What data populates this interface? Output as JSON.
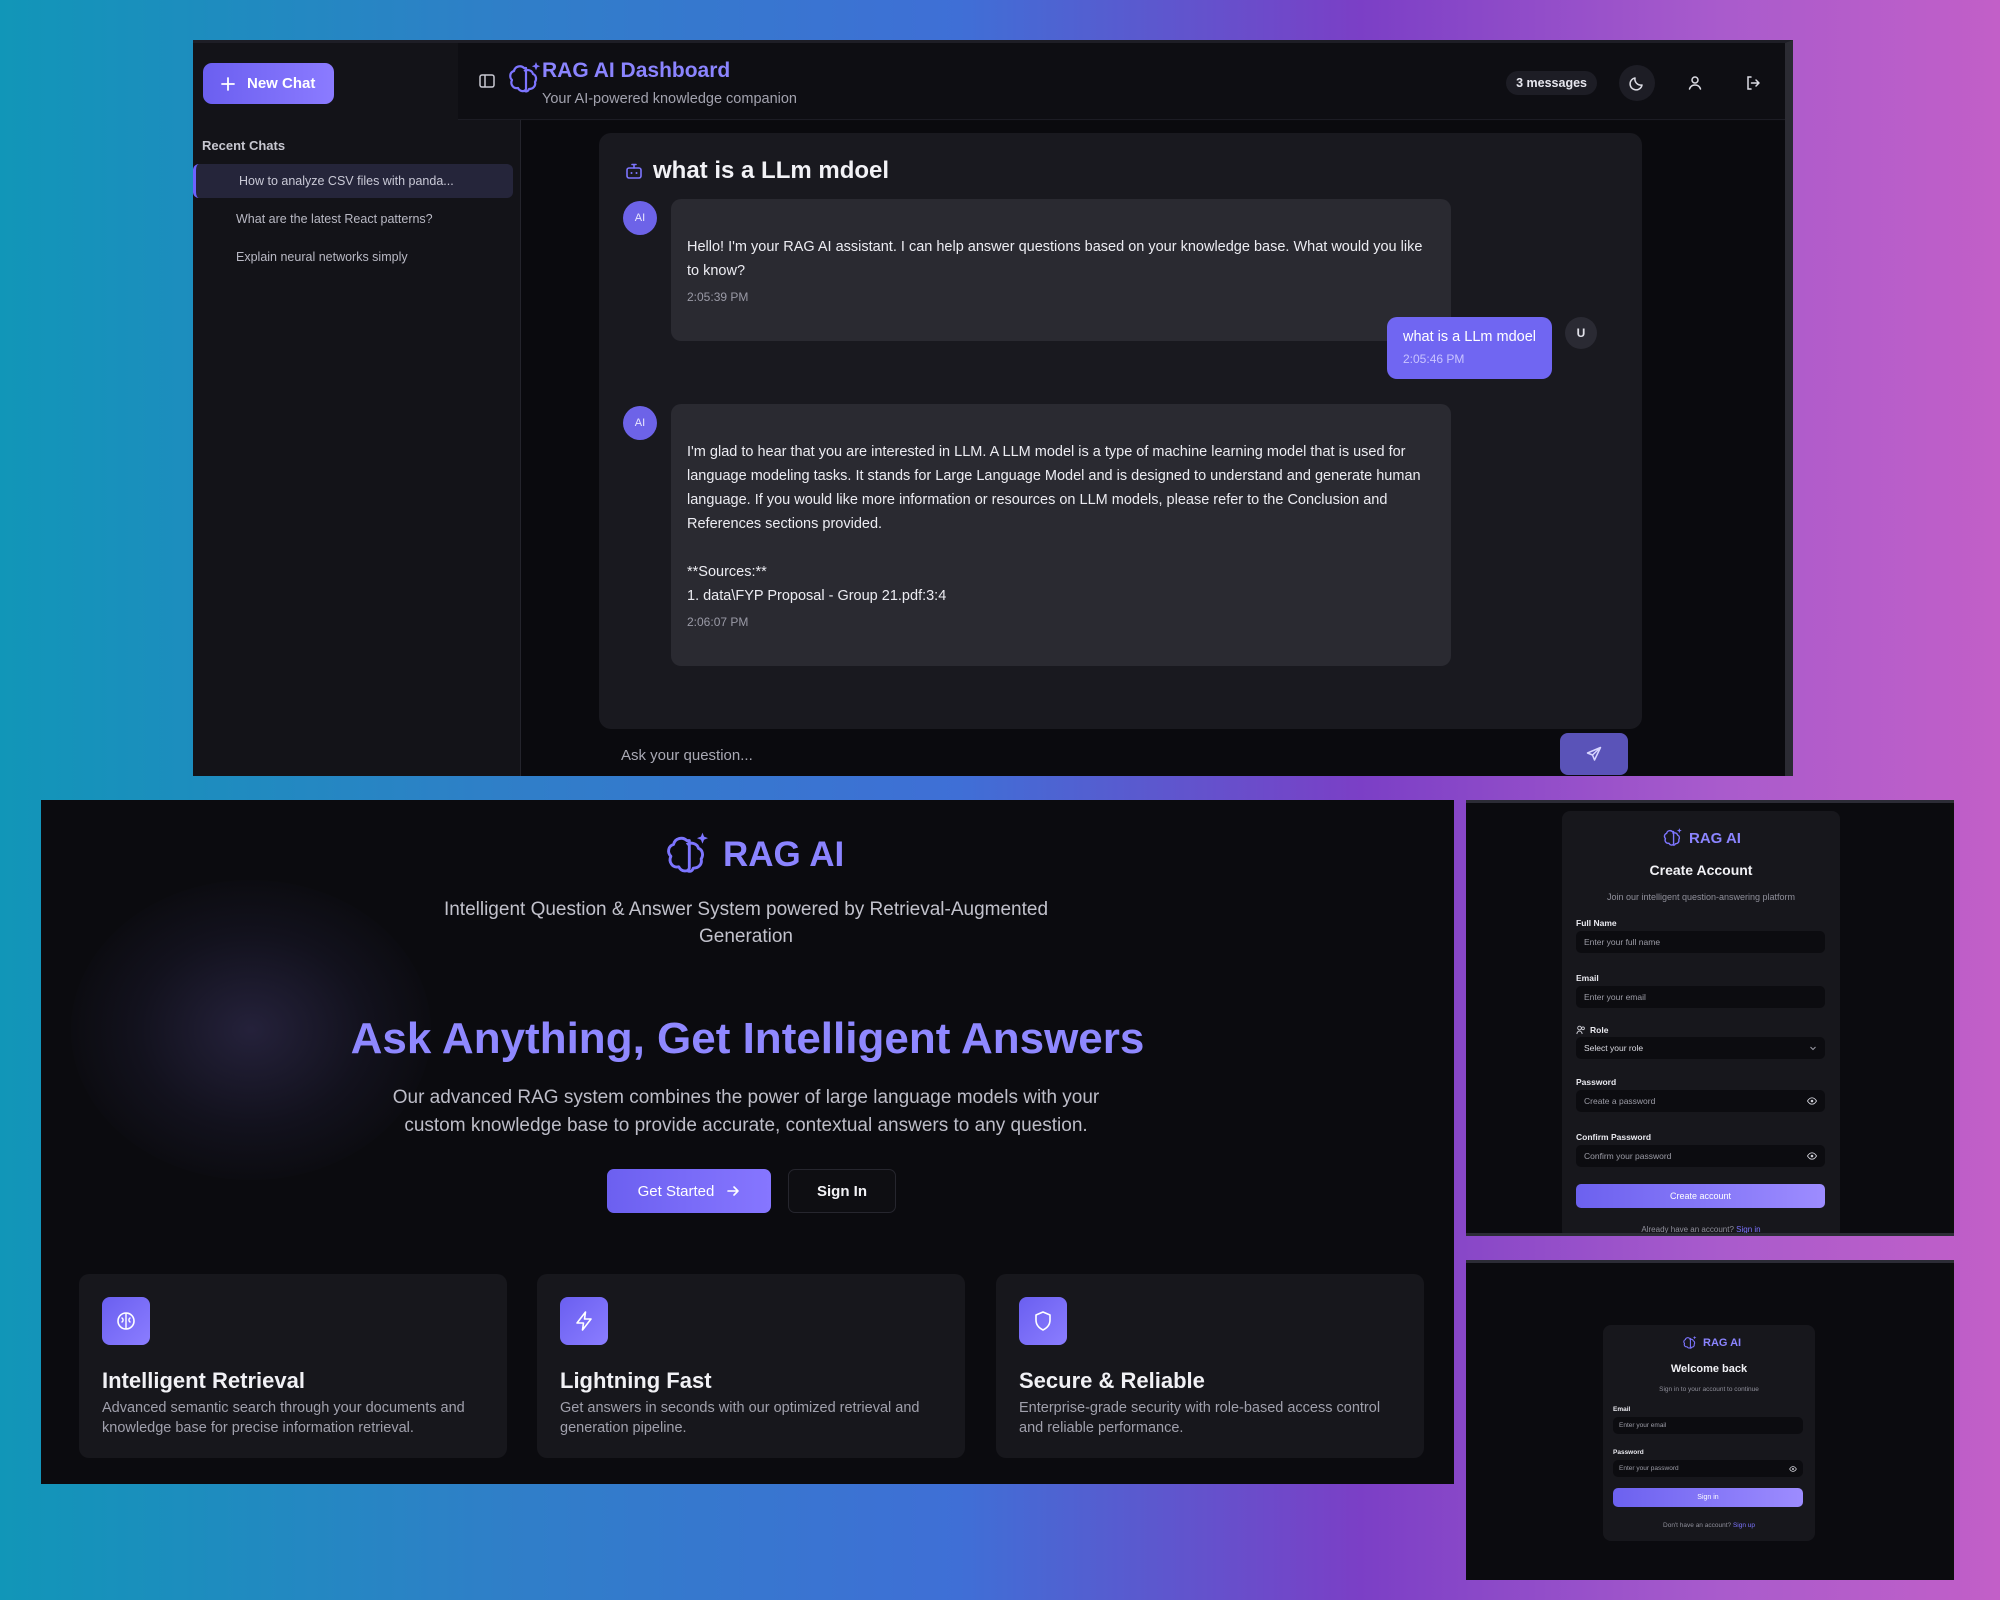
{
  "dashboard": {
    "sidebar": {
      "new_chat_label": "New Chat",
      "recent_title": "Recent Chats",
      "chats": [
        {
          "label": "How to analyze CSV files with panda..."
        },
        {
          "label": "What are the latest React patterns?"
        },
        {
          "label": "Explain neural networks simply"
        }
      ]
    },
    "header": {
      "title": "RAG AI Dashboard",
      "subtitle": "Your AI-powered knowledge companion",
      "message_count": "3 messages"
    },
    "chat": {
      "title": "what is a LLm mdoel",
      "messages": [
        {
          "role": "ai",
          "avatar": "AI",
          "text": "Hello! I'm your RAG AI assistant. I can help answer questions based on your knowledge base. What would you like to know?",
          "time": "2:05:39 PM"
        },
        {
          "role": "user",
          "avatar": "U",
          "text": "what is a LLm mdoel",
          "time": "2:05:46 PM"
        },
        {
          "role": "ai",
          "avatar": "AI",
          "text": "I'm glad to hear that you are interested in LLM. A LLM model is a type of machine learning model that is used for language modeling tasks. It stands for Large Language Model and is designed to understand and generate human language. If you would like more information or resources on LLM models, please refer to the Conclusion and References sections provided.\n\n**Sources:**\n1. data\\FYP Proposal - Group 21.pdf:3:4",
          "time": "2:06:07 PM"
        }
      ]
    },
    "input": {
      "placeholder": "Ask your question..."
    }
  },
  "landing": {
    "brand": "RAG AI",
    "subtitle": "Intelligent Question & Answer System powered by Retrieval-Augmented Generation",
    "hero": "Ask Anything, Get Intelligent Answers",
    "description": "Our advanced RAG system combines the power of large language models with your custom knowledge base to provide accurate, contextual answers to any question.",
    "get_started": "Get Started",
    "sign_in": "Sign In",
    "features": [
      {
        "icon": "brain-icon",
        "title": "Intelligent Retrieval",
        "desc": "Advanced semantic search through your documents and knowledge base for precise information retrieval."
      },
      {
        "icon": "lightning-icon",
        "title": "Lightning Fast",
        "desc": "Get answers in seconds with our optimized retrieval and generation pipeline."
      },
      {
        "icon": "shield-icon",
        "title": "Secure & Reliable",
        "desc": "Enterprise-grade security with role-based access control and reliable performance."
      }
    ]
  },
  "register": {
    "brand": "RAG AI",
    "title": "Create Account",
    "subtitle": "Join our intelligent question-answering platform",
    "full_name_label": "Full Name",
    "full_name_placeholder": "Enter your full name",
    "email_label": "Email",
    "email_placeholder": "Enter your email",
    "role_label": "Role",
    "role_placeholder": "Select your role",
    "password_label": "Password",
    "password_placeholder": "Create a password",
    "confirm_label": "Confirm Password",
    "confirm_placeholder": "Confirm your password",
    "submit": "Create account",
    "footer": "Already have an account?",
    "footer_link": "Sign in"
  },
  "login": {
    "brand": "RAG AI",
    "title": "Welcome back",
    "subtitle": "Sign in to your account to continue",
    "email_label": "Email",
    "email_placeholder": "Enter your email",
    "password_label": "Password",
    "password_placeholder": "Enter your password",
    "submit": "Sign in",
    "footer": "Don't have an account?",
    "footer_link": "Sign up"
  },
  "colors": {
    "accent": "#7066f2",
    "background": "#0b0b0f",
    "card": "#17171c"
  }
}
